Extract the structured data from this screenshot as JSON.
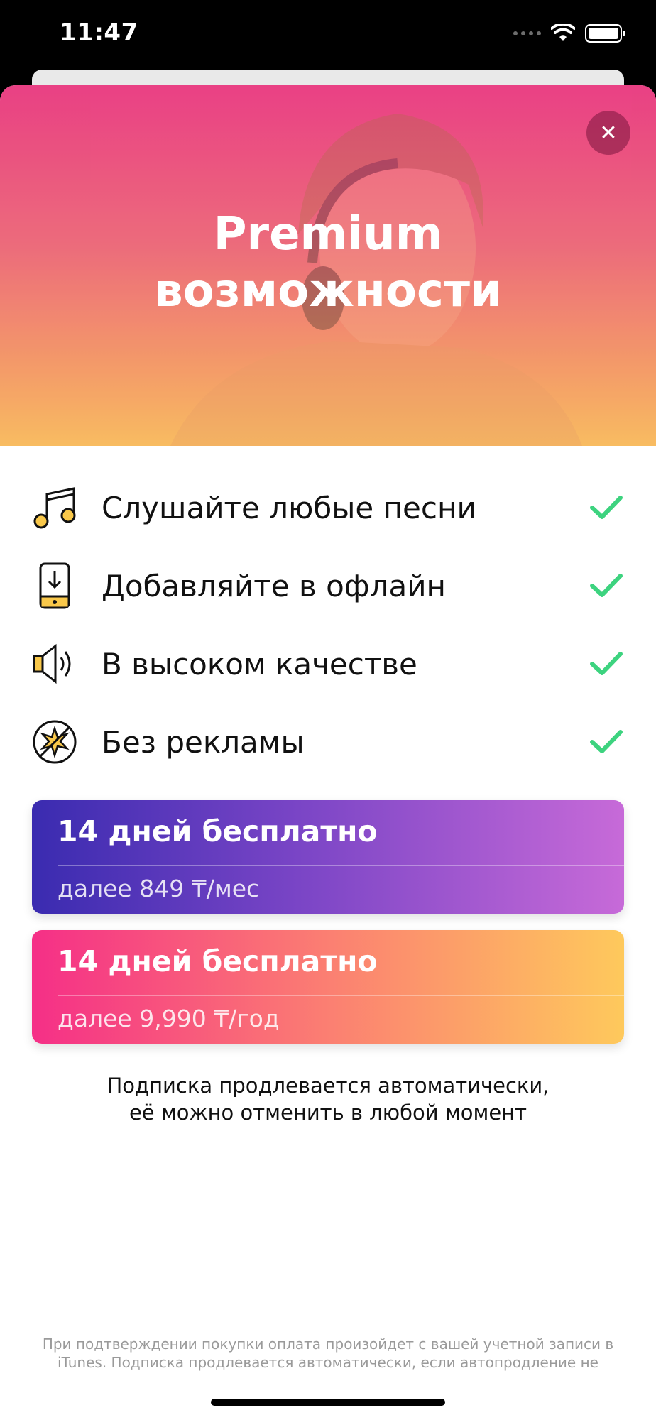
{
  "status_bar": {
    "time": "11:47"
  },
  "hero": {
    "title_line1": "Premium",
    "title_line2": "возможности",
    "close_icon": "close-icon"
  },
  "features": [
    {
      "icon": "music-notes-icon",
      "label": "Слушайте любые песни",
      "check": "check-icon"
    },
    {
      "icon": "phone-download-icon",
      "label": "Добавляйте в офлайн",
      "check": "check-icon"
    },
    {
      "icon": "speaker-icon",
      "label": "В высоком качестве",
      "check": "check-icon"
    },
    {
      "icon": "no-ads-icon",
      "label": "Без рекламы",
      "check": "check-icon"
    }
  ],
  "plans": [
    {
      "title": "14 дней бесплатно",
      "subtitle": "далее 849 ₸/мес"
    },
    {
      "title": "14 дней бесплатно",
      "subtitle": "далее 9,990 ₸/год"
    }
  ],
  "note": {
    "line1": "Подписка продлевается автоматически,",
    "line2": "её можно отменить в любой момент"
  },
  "legal": "При подтверждении покупки оплата произойдет с вашей учетной записи в iTunes. Подписка продлевается автоматически, если автопродление не",
  "colors": {
    "check": "#3dd37f",
    "icon_yellow": "#f9c84a",
    "plan_a": [
      "#3a2bb0",
      "#c76ad8"
    ],
    "plan_b": [
      "#f52f87",
      "#fec95c"
    ]
  }
}
